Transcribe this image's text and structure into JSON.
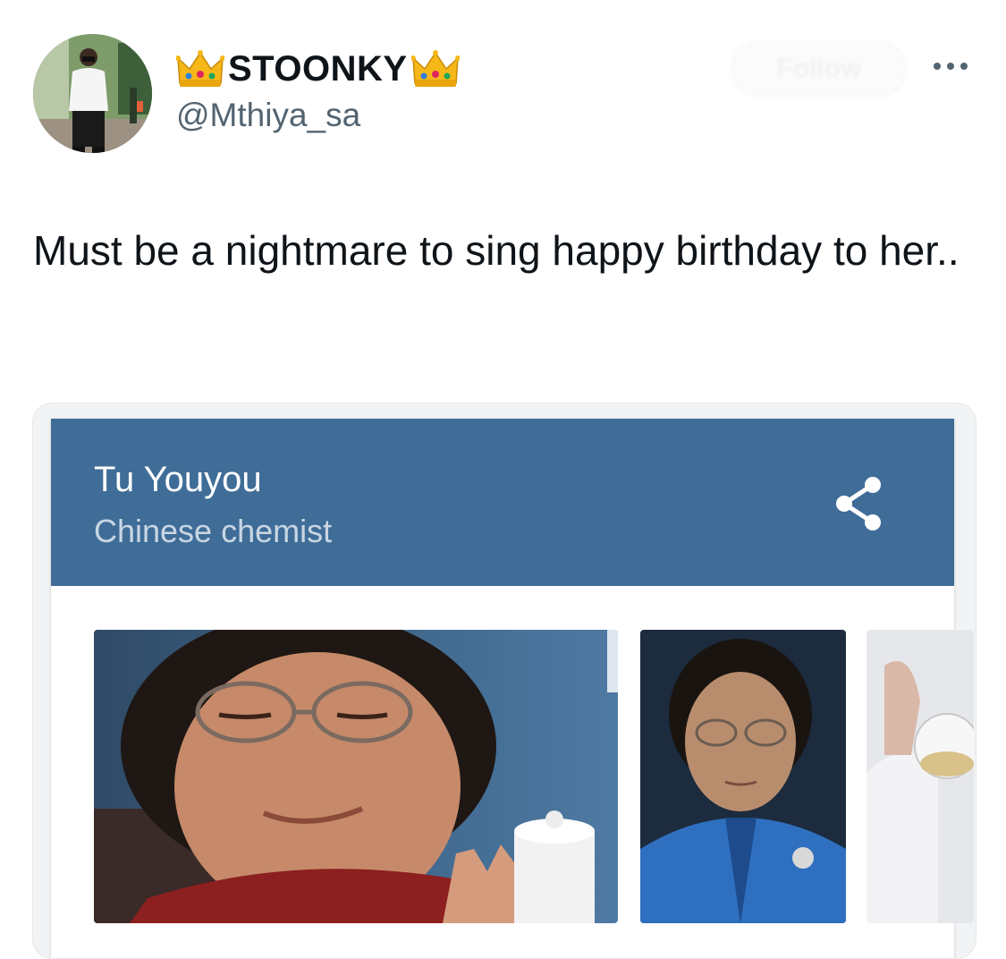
{
  "tweet": {
    "author": {
      "display_name": "STOONKY",
      "handle": "@Mthiya_sa",
      "name_decoration_icon": "crown-emoji"
    },
    "follow_label": "Follow",
    "more_icon": "more-horizontal-icon",
    "text": "Must be a nightmare to sing happy birthday to her.."
  },
  "embedded_screenshot": {
    "header_color": "#3f6d98",
    "title": "Tu Youyou",
    "subtitle": "Chinese chemist",
    "share_icon": "share-icon",
    "photo_count": 3
  }
}
